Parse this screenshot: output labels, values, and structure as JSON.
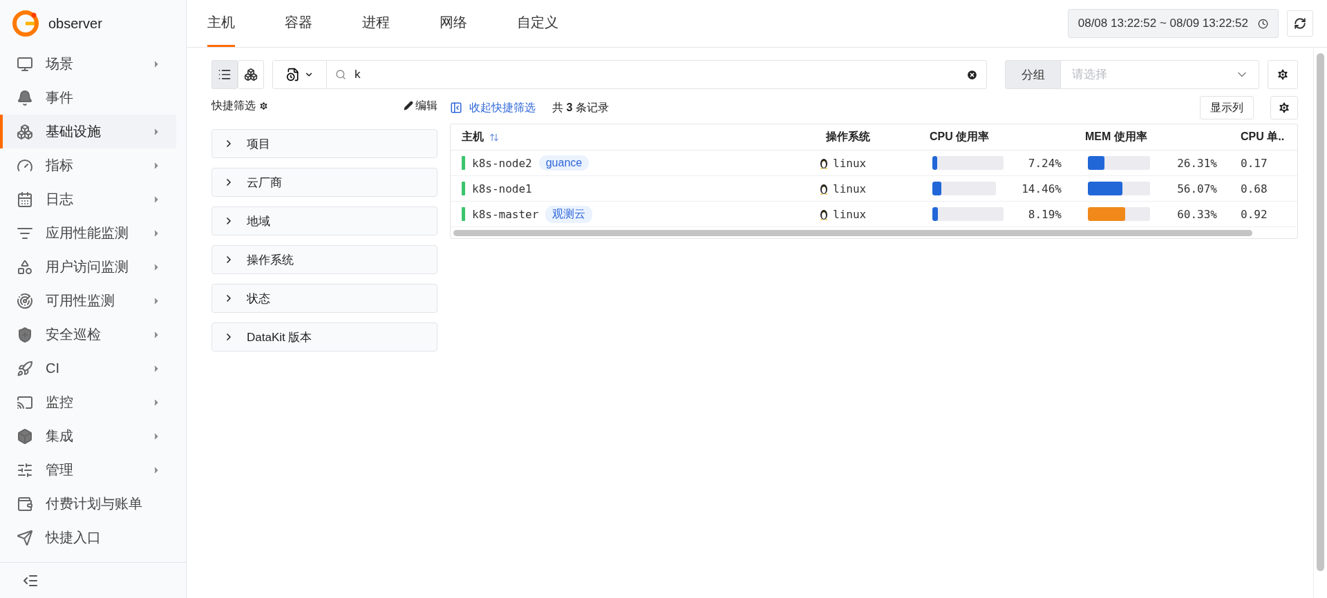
{
  "brand": {
    "name": "observer"
  },
  "sidebar": {
    "items": [
      {
        "label": "场景",
        "has_submenu": true,
        "selected": false
      },
      {
        "label": "事件",
        "has_submenu": false,
        "selected": false
      },
      {
        "label": "基础设施",
        "has_submenu": true,
        "selected": true
      },
      {
        "label": "指标",
        "has_submenu": true,
        "selected": false
      },
      {
        "label": "日志",
        "has_submenu": true,
        "selected": false
      },
      {
        "label": "应用性能监测",
        "has_submenu": true,
        "selected": false
      },
      {
        "label": "用户访问监测",
        "has_submenu": true,
        "selected": false
      },
      {
        "label": "可用性监测",
        "has_submenu": true,
        "selected": false
      },
      {
        "label": "安全巡检",
        "has_submenu": true,
        "selected": false
      },
      {
        "label": "CI",
        "has_submenu": true,
        "selected": false
      },
      {
        "label": "监控",
        "has_submenu": true,
        "selected": false
      },
      {
        "label": "集成",
        "has_submenu": true,
        "selected": false
      },
      {
        "label": "管理",
        "has_submenu": true,
        "selected": false
      },
      {
        "label": "付费计划与账单",
        "has_submenu": false,
        "selected": false
      },
      {
        "label": "快捷入口",
        "has_submenu": false,
        "selected": false
      }
    ]
  },
  "tabs": [
    {
      "label": "主机",
      "selected": true
    },
    {
      "label": "容器",
      "selected": false
    },
    {
      "label": "进程",
      "selected": false
    },
    {
      "label": "网络",
      "selected": false
    },
    {
      "label": "自定义",
      "selected": false
    }
  ],
  "time_range": "08/08 13:22:52 ~ 08/09 13:22:52",
  "view_toggle": [
    {
      "kind": "list",
      "selected": true
    },
    {
      "kind": "hex",
      "selected": false
    }
  ],
  "search": {
    "value": "k"
  },
  "group": {
    "label": "分组",
    "placeholder": "请选择"
  },
  "quick_filter": {
    "title": "快捷筛选",
    "edit": "编辑",
    "collapse": "收起快捷筛选",
    "count": "共 **3** 条记录",
    "sections": [
      "项目",
      "云厂商",
      "地域",
      "操作系统",
      "状态",
      "DataKit 版本"
    ]
  },
  "show_columns": "显示列",
  "table": {
    "columns": [
      "主机",
      "操作系统",
      "CPU 使用率",
      "MEM 使用率",
      "CPU 单.."
    ],
    "rows": [
      {
        "host": "k8s-node2",
        "tag": "guance",
        "os": "linux",
        "cpu": {
          "level": 0.0724,
          "reading": "7.24%",
          "color": "#2167d8"
        },
        "mem": {
          "level": 0.2631,
          "reading": "26.31%",
          "color": "#2167d8"
        },
        "load": "0.17"
      },
      {
        "host": "k8s-node1",
        "os": "linux",
        "cpu": {
          "level": 0.1446,
          "reading": "14.46%",
          "color": "#2167d8"
        },
        "mem": {
          "level": 0.5607,
          "reading": "56.07%",
          "color": "#2167d8"
        },
        "load": "0.68"
      },
      {
        "host": "k8s-master",
        "tag": "观测云",
        "os": "linux",
        "cpu": {
          "level": 0.0819,
          "reading": "8.19%",
          "color": "#2167d8"
        },
        "mem": {
          "level": 0.6033,
          "reading": "60.33%",
          "color": "#f0891a"
        },
        "load": "0.92"
      }
    ]
  }
}
